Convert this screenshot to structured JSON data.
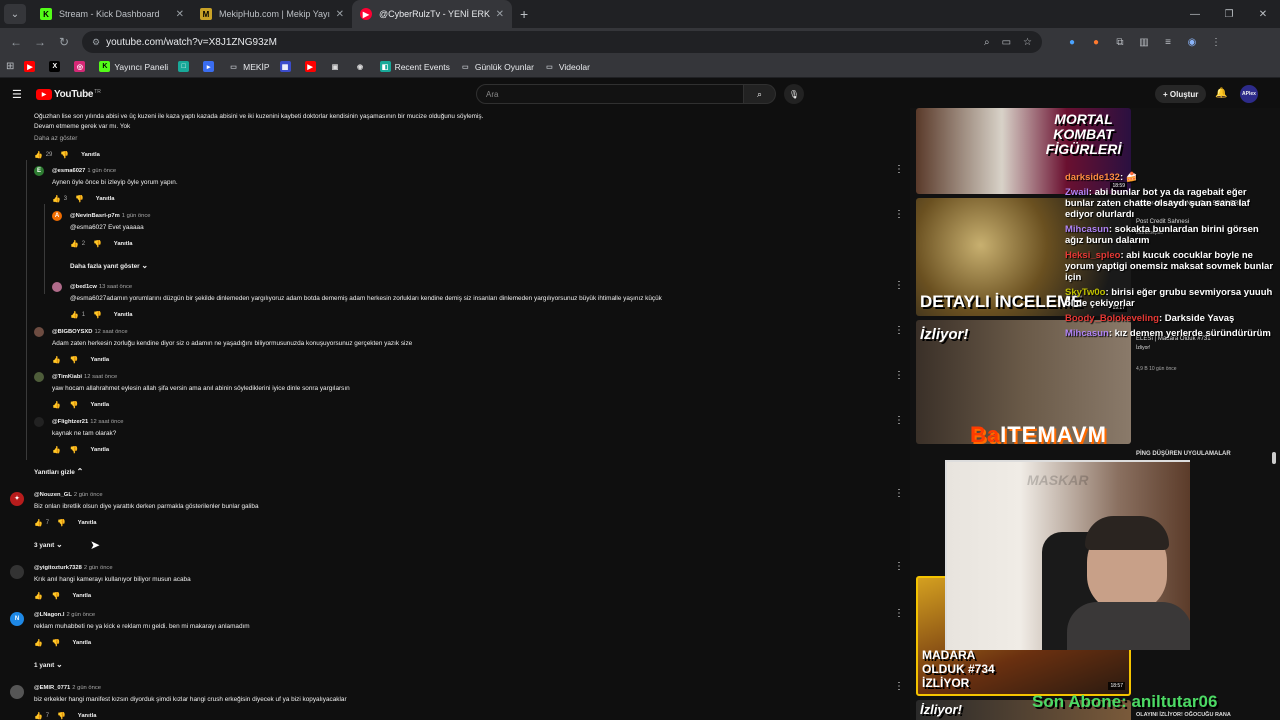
{
  "tabs": [
    {
      "title": "Stream - Kick Dashboard",
      "icon": "K",
      "color": "#53fc18"
    },
    {
      "title": "MekipHub.com | Mekip Yayıncı",
      "icon": "M",
      "color": "#c9a227"
    },
    {
      "title": "@CyberRulzTv - YENİ ERKEK M",
      "icon": "▶",
      "color": "#ff0033"
    }
  ],
  "address": {
    "url": "youtube.com/watch?v=X8J1ZNG93zM"
  },
  "bookmarks": [
    {
      "label": "",
      "icon": "▶",
      "color": "#ff0000"
    },
    {
      "label": "",
      "icon": "X",
      "color": "#000000"
    },
    {
      "label": "",
      "icon": "◎",
      "color": "#d62976"
    },
    {
      "label": "Yayıncı Paneli",
      "icon": "K",
      "color": "#53fc18"
    },
    {
      "label": "",
      "icon": "□",
      "color": "#18a999"
    },
    {
      "label": "",
      "icon": "▸",
      "color": "#3a6df0"
    },
    {
      "label": "MEKİP",
      "icon": "▭",
      "color": "#555555"
    },
    {
      "label": "",
      "icon": "▦",
      "color": "#3b4cca"
    },
    {
      "label": "",
      "icon": "▶",
      "color": "#ff0000"
    },
    {
      "label": "",
      "icon": "▣",
      "color": "#666666"
    },
    {
      "label": "",
      "icon": "◉",
      "color": "#888888"
    },
    {
      "label": "Recent Events",
      "icon": "◧",
      "color": "#18a999"
    },
    {
      "label": "Günlük Oyunlar",
      "icon": "▭",
      "color": "#555555"
    },
    {
      "label": "Videolar",
      "icon": "▭",
      "color": "#555555"
    }
  ],
  "youtube": {
    "logo": "YouTube",
    "region": "TR",
    "search_placeholder": "Ara",
    "create_label": "+ Oluştur",
    "avatar_text": "APlex"
  },
  "comments": {
    "top_text_1": "Oğuzhan lise son yılında abisi ve üç kuzeni ile kaza yaptı kazada abisini ve iki kuzenini kaybeti doktorlar kendisinin yaşamasının bir mucize olduğunu söylemiş.",
    "top_text_2": "Devam etmeme gerek var mı. Yok",
    "show_less": "Daha az göster",
    "top_likes": "29",
    "reply_label": "Yanıtla",
    "more_replies": "Daha fazla yanıt göster",
    "hide_replies": "Yanıtları gizle",
    "items": [
      {
        "handle": "@esma6027",
        "time": "1 gün önce",
        "text": "Aynen öyle önce bi izleyip öyle yorum yapın.",
        "likes": "3",
        "avatar": "E",
        "avcolor": "#2e7d32"
      },
      {
        "handle": "@NevinBasri-p7m",
        "time": "1 gün önce",
        "text": "@esma6027 Evet yaaaaa",
        "likes": "2",
        "avatar": "A",
        "avcolor": "#ef6c00"
      },
      {
        "handle": "@bed1cw",
        "time": "13 saat önce",
        "text": "@esma6027adamın yorumlarını düzgün bir şekilde dinlemeden yargılıyoruz adam botda dememiş adam herkesin zorlukları kendine demiş siz insanları dinlemeden yargılıyorsunuz büyük ihtimalle yaşınız küçük",
        "likes": "1",
        "avatar": "",
        "avcolor": "#b06b8a"
      },
      {
        "handle": "@BIGBOYSXD",
        "time": "12 saat önce",
        "text": "Adam zaten herkesin zorluğu kendine diyor siz o adamın ne yaşadığını biliyormusunuzda konuşuyorsunuz gerçekten yazık size",
        "likes": "",
        "avatar": "",
        "avcolor": "#6d4c41"
      },
      {
        "handle": "@TimKiabi",
        "time": "12 saat önce",
        "text": "yaw hocam allahrahmet eylesin allah şifa versin ama anıl abinin söylediklerini iyice dinle sonra yargılarsın",
        "likes": "",
        "avatar": "",
        "avcolor": "#4e5d3a"
      },
      {
        "handle": "@Flightzer21",
        "time": "12 saat önce",
        "text": "kaynak ne tam olarak?",
        "likes": "",
        "avatar": "",
        "avcolor": "#222222"
      },
      {
        "handle": "@Nouzen_GL",
        "time": "2 gün önce",
        "text": "Biz onları ibretlik olsun diye yarattık derken parmakla gösterilenler bunlar galiba",
        "likes": "7",
        "avatar": "✦",
        "avcolor": "#b71c1c"
      },
      {
        "handle": "@yigitozturk7328",
        "time": "2 gün önce",
        "text": "Krık anıl hangi kamerayı kullanıyor biliyor musun acaba",
        "likes": "",
        "avatar": "",
        "avcolor": "#333333"
      },
      {
        "handle": "@LNagon.l",
        "time": "2 gün önce",
        "text": "reklam muhabbeti ne ya kick e reklam mı geldi. ben mi makarayı anlamadım",
        "likes": "",
        "avatar": "N",
        "avcolor": "#1e88e5"
      },
      {
        "handle": "@EMIR_0771",
        "time": "2 gün önce",
        "text": "biz erkekler hangi manifest kızsın diyorduk şimdi kızlar hangi crush erkeğisin diyecek uf ya bizi kopyalıyacaklar",
        "likes": "7",
        "avatar": "",
        "avcolor": "#555555"
      }
    ],
    "replies_3": "3 yanıt",
    "replies_1": "1 yanıt"
  },
  "video": {
    "thumb1_text": "MORTAL KOMBAT FİGÜRLERİ",
    "thumb1_dur": "18:59",
    "thumb2_text": "DETAYLI İNCELEME",
    "thumb2_dur": "19:17",
    "thumb3_text": "İzliyor!",
    "thumb4_text": "MADARA OLDUK #734 İZLİYOR",
    "thumb4_dur": "18:57",
    "thumb5_text": "İzliyor!",
    "rec1_title": "Spider-Man Brand New Day SPOİLERLI",
    "rec1_sub": "Post Credit Sahnesi",
    "rec1_channel": "Markeseptic",
    "rec2_title": "ELESI | Madara Olduk #731",
    "rec2_sub": "İzliyor!",
    "rec2_meta": "4,9 B   10 gün önce",
    "rec3_title": "PİNG DÜŞÜREN UYGULAMALAR",
    "bottom_rec": "OLAYINI İZLİYOR! OĞOCUĞU RANA",
    "overlay_logo": "ITEMAVM",
    "overlay_logo_prefix": "Ba",
    "webcam_label": "MASKAR",
    "last_sub_label": "Son Abone: aniltutar06"
  },
  "chat": [
    {
      "name": "darkside132",
      "text": ": 🍰",
      "color": "#ff8c42"
    },
    {
      "name": "Zwail",
      "text": ": abi bunlar bot ya da ragebait eğer bunlar zaten chatte olsaydı şuan sana laf ediyor olurlardı",
      "color": "#b084f5"
    },
    {
      "name": "Mihcasun",
      "text": ": sokakta bunlardan birini görsen ağız burun dalarım",
      "color": "#b084f5"
    },
    {
      "name": "Heksi_spleo",
      "text": ": abi kucuk cocuklar boyle ne yorum yaptigi onemsiz maksat sovmek bunlar için",
      "color": "#e53935"
    },
    {
      "name": "SkyTw0o",
      "text": ": birisi eğer grubu sevmiyorsa yuuuh öl de çekiyorlar",
      "color": "#c0c000"
    },
    {
      "name": "Boody_Bolokeveling",
      "text": ": Darkside Yavaş",
      "color": "#e53935"
    },
    {
      "name": "Mihcasun",
      "text": ": kız demem yerlerde süründürürüm",
      "color": "#b084f5"
    }
  ]
}
